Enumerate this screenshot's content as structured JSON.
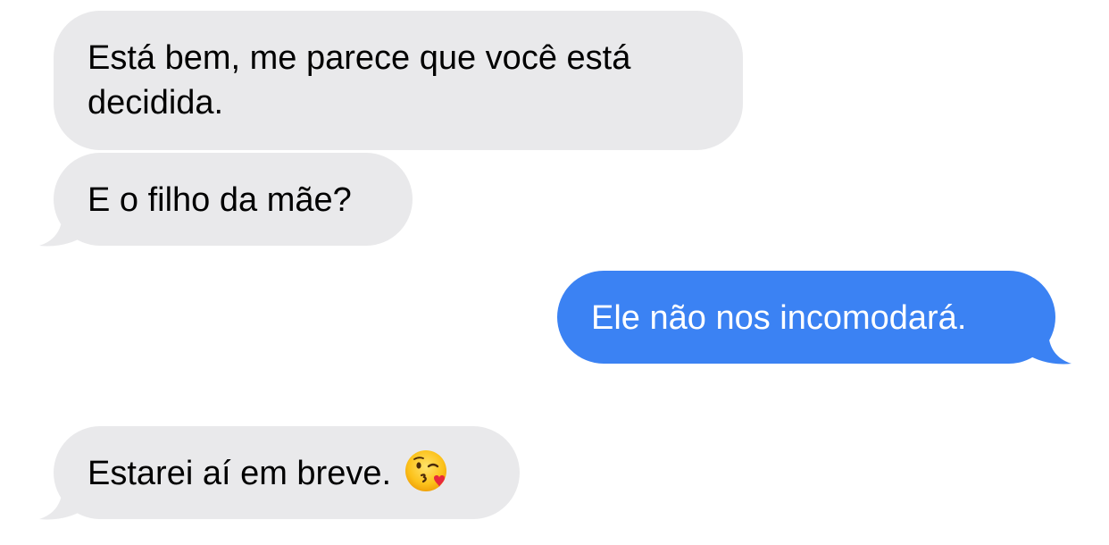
{
  "messages": [
    {
      "direction": "received",
      "text": "Está bem, me parece que você está\ndecidida."
    },
    {
      "direction": "received",
      "text": "E o filho da mãe?"
    },
    {
      "direction": "sent",
      "text": "Ele não nos incomodará."
    },
    {
      "direction": "received",
      "text": "Estarei aí em breve.",
      "emoji": "kissing-face-with-heart-emoji"
    }
  ],
  "colors": {
    "received_bubble": "#e9e9eb",
    "sent_bubble": "#3b82f3",
    "received_text": "#000000",
    "sent_text": "#ffffff",
    "background": "#ffffff"
  }
}
